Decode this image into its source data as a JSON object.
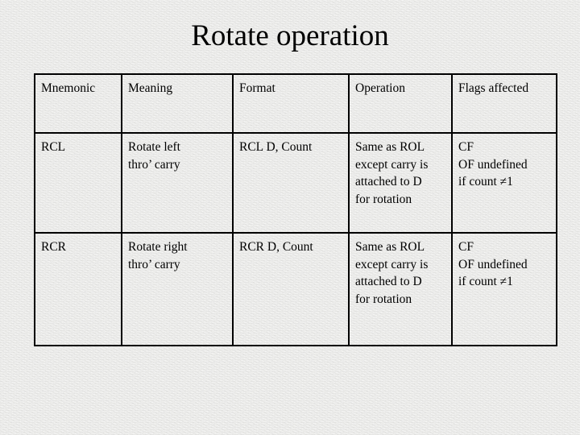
{
  "slide": {
    "title": "Rotate operation",
    "background_color": "#eeeeec",
    "text_color": "#000000",
    "border_color": "#000000"
  },
  "table": {
    "headers": [
      "Mnemonic",
      "Meaning",
      "Format",
      "Operation",
      "Flags affected"
    ],
    "rows": [
      {
        "mnemonic": "RCL",
        "meaning_line1": "Rotate left",
        "meaning_line2": "thro’ carry",
        "format": "RCL D, Count",
        "operation_line1": "Same as ROL",
        "operation_line2": "except carry is",
        "operation_line3": "attached to D",
        "operation_line4": "for rotation",
        "flags_line1": "CF",
        "flags_line2": "OF undefined",
        "flags_line3": "if count ≠1"
      },
      {
        "mnemonic": "RCR",
        "meaning_line1": "Rotate right",
        "meaning_line2": "thro’ carry",
        "format": "RCR D, Count",
        "operation_line1": "Same as ROL",
        "operation_line2": "except carry is",
        "operation_line3": "attached to D",
        "operation_line4": "for rotation",
        "flags_line1": "CF",
        "flags_line2": "OF undefined",
        "flags_line3": "if count ≠1"
      }
    ]
  }
}
